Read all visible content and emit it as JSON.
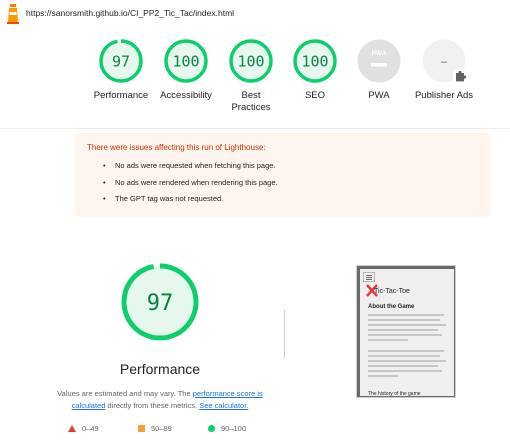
{
  "url": "https://sanorsmith.github.io/CI_PP2_Tic_Tac/index.html",
  "colors": {
    "pass": "#0cce6b",
    "pass_text": "#0b8043",
    "average": "#f4a13c",
    "fail": "#e53935",
    "na": "#e0e0e0",
    "warning_bg": "#fff5ef",
    "warning_text": "#c33300",
    "link": "#1a73e8"
  },
  "categories": [
    {
      "label": "Performance",
      "score": "97",
      "fraction": 0.97
    },
    {
      "label": "Accessibility",
      "score": "100",
      "fraction": 1.0
    },
    {
      "label": "Best Practices",
      "score": "100",
      "fraction": 1.0
    },
    {
      "label": "SEO",
      "score": "100",
      "fraction": 1.0
    },
    {
      "label": "PWA",
      "badge": "PWA"
    },
    {
      "label": "Publisher Ads",
      "score": "–",
      "icon": "puzzle-icon"
    }
  ],
  "warning": {
    "title": "There were issues affecting this run of Lighthouse:",
    "items": [
      "No ads were requested when fetching this page.",
      "No ads were rendered when rendering this page.",
      "The GPT tag was not requested."
    ]
  },
  "summary": {
    "score": "97",
    "fraction": 0.97,
    "title": "Performance",
    "note_prefix": "Values are estimated and may vary. The",
    "note_link1": "performance score is calculated",
    "note_middle": "directly from these metrics.",
    "note_link2": "See calculator."
  },
  "legend": [
    {
      "label": "0–49",
      "icon": "triangle-icon"
    },
    {
      "label": "50–89",
      "icon": "square-icon"
    },
    {
      "label": "90–100",
      "icon": "circle-icon"
    }
  ],
  "screenshot": {
    "title": "Tic-Tac-Toe",
    "heading": "About the Game",
    "footer_heading": "The history of the game"
  }
}
